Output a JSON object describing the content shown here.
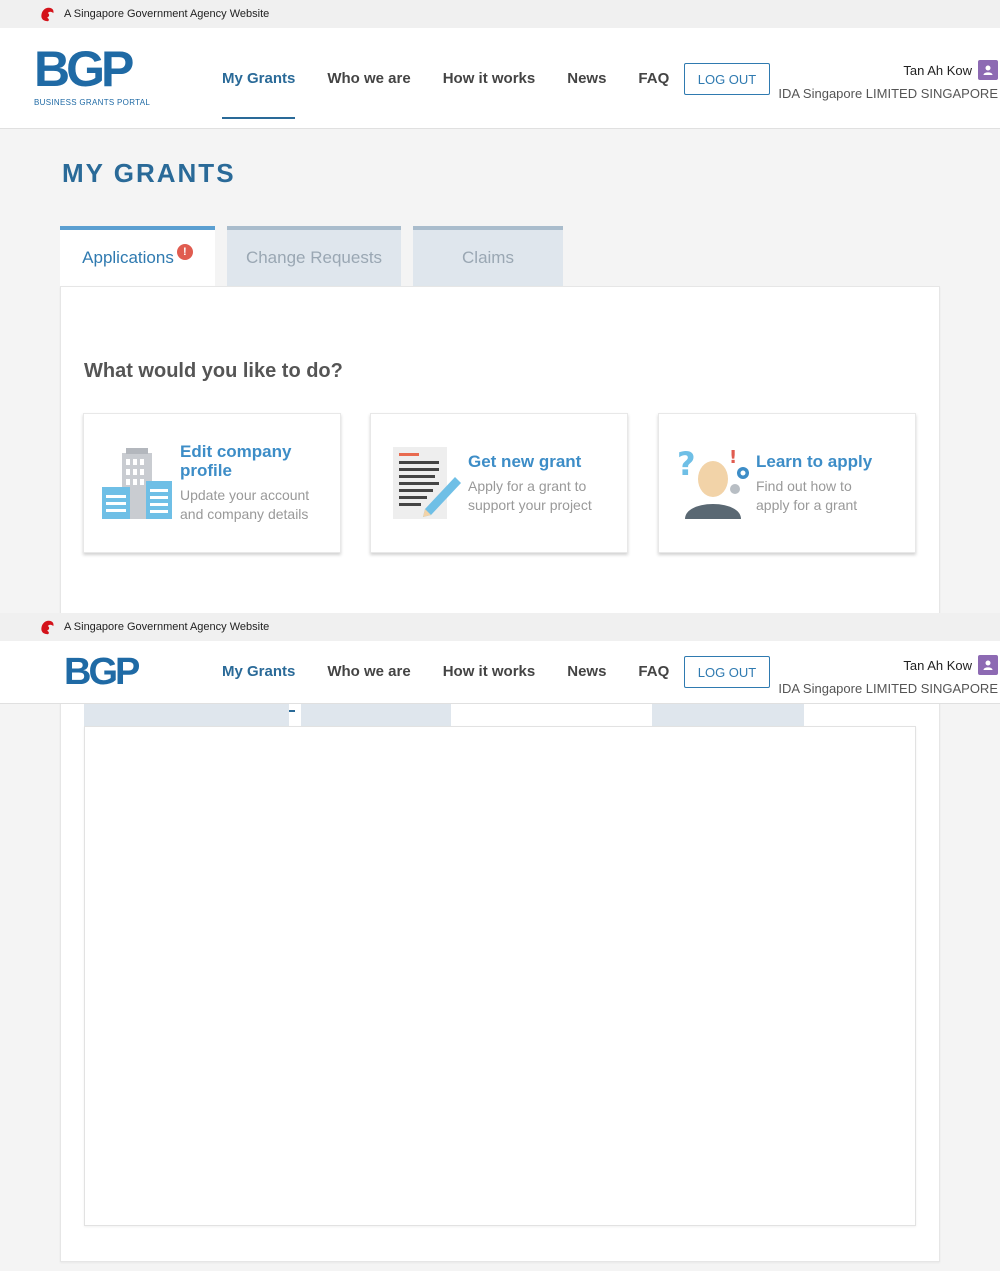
{
  "gov_bar": {
    "text": "A Singapore Government Agency Website"
  },
  "logo": {
    "text": "BGP",
    "subtitle": "BUSINESS GRANTS PORTAL"
  },
  "nav": {
    "items": [
      "My Grants",
      "Who we are",
      "How it works",
      "News",
      "FAQ"
    ],
    "active": "My Grants",
    "logout_label": "LOG OUT"
  },
  "user": {
    "name": "Tan Ah Kow",
    "company": "IDA Singapore LIMITED SINGAPORE"
  },
  "page_title": "MY GRANTS",
  "tabs": [
    {
      "label": "Applications",
      "badge": "!"
    },
    {
      "label": "Change Requests"
    },
    {
      "label": "Claims"
    }
  ],
  "question": "What would you like to do?",
  "cards": [
    {
      "title": "Edit company profile",
      "desc": "Update your account and company details",
      "icon": "buildings-icon"
    },
    {
      "title": "Get new grant",
      "desc": "Apply for a grant to support your project",
      "icon": "document-pen-icon"
    },
    {
      "title": "Learn to apply",
      "desc": "Find out how to apply for a grant",
      "icon": "question-person-icon"
    }
  ],
  "colors": {
    "brand": "#2a6a98",
    "accent": "#3d8dc7",
    "badge": "#e05c50",
    "avatar": "#8d6ab3"
  }
}
